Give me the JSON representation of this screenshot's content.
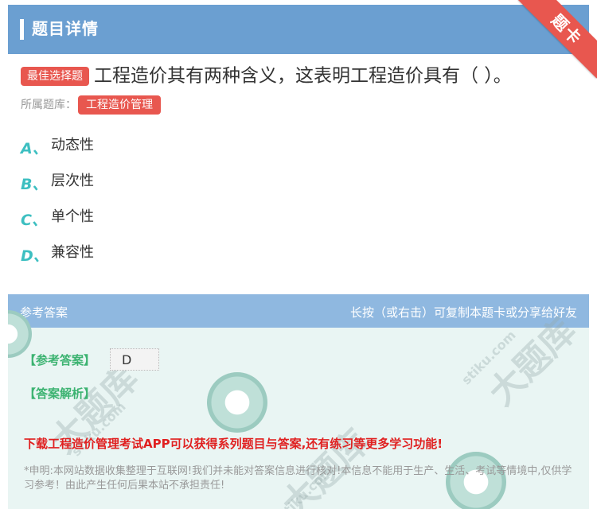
{
  "header": {
    "title": "题目详情",
    "ribbon_label": "题卡"
  },
  "question": {
    "type_badge": "最佳选择题",
    "text": "工程造价其有两种含义，这表明工程造价具有（ ）。",
    "bank_label": "所属题库：",
    "bank_name": "工程造价管理"
  },
  "options": [
    {
      "letter": "A、",
      "text": "动态性"
    },
    {
      "letter": "B、",
      "text": "层次性"
    },
    {
      "letter": "C、",
      "text": "单个性"
    },
    {
      "letter": "D、",
      "text": "兼容性"
    }
  ],
  "answer": {
    "panel_title": "参考答案",
    "share_hint": "长按（或右击）可复制本题卡或分享给好友",
    "answer_label": "【参考答案】",
    "answer_value": "D",
    "analysis_label": "【答案解析】",
    "promo": "下载工程造价管理考试APP可以获得系列题目与答案,还有练习等更多学习功能!",
    "disclaimer": "*申明:本网站数据收集整理于互联网!我们并未能对答案信息进行核对!本信息不能用于生产、生活、考试等情境中,仅供学习参考！由此产生任何后果本站不承担责任!"
  },
  "watermark": {
    "text": "大题库",
    "url": "stiku.com"
  },
  "colors": {
    "header_bg": "#6b9fd1",
    "accent_red": "#e8574f",
    "option_letter": "#3dbfc1",
    "answer_panel_bg": "#e9f5f3",
    "answer_green": "#3cb371",
    "promo_red": "#e02020"
  }
}
